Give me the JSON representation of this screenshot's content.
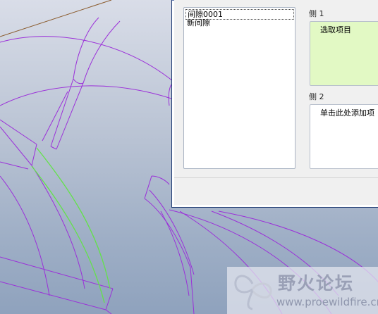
{
  "interference_list": {
    "items": [
      {
        "label": "间隙0001",
        "selected": true
      },
      {
        "label": "新间隙",
        "selected": false
      }
    ]
  },
  "side1": {
    "label": "侧 1",
    "text": "选取项目"
  },
  "side2": {
    "label": "侧 2",
    "text": "单击此处添加项"
  },
  "watermark": {
    "title": "野火论坛",
    "url": "www.proewildfire.cn"
  },
  "colors": {
    "wireframe": "#9b30d9",
    "highlight": "#63e24a",
    "axis": "#8a5a2b",
    "side1_fill": "#e2f9c4"
  }
}
